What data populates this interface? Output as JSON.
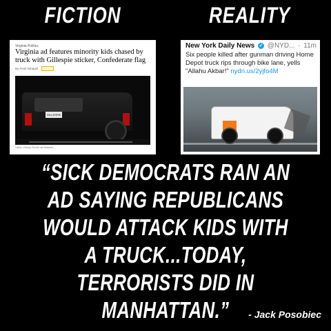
{
  "titles": {
    "left": "FICTION",
    "right": "REALITY"
  },
  "left_card": {
    "kicker": "Virginia Politics",
    "headline": "Virginia ad features minority kids chased by truck with Gillespie sticker, Confederate flag",
    "byline": "By Fenit Nirappil",
    "plate_text": "GILLESPIE",
    "caption": "Latino Victory Fund's ad features..."
  },
  "right_card": {
    "account_name": "New York Daily News",
    "handle": "@NYD...",
    "time": "11m",
    "tweet_text": "Six people killed after gunman driving Home Depot truck rips through bike lane, yells \"Allahu Akbar!\"",
    "link": "nydn.us/2yjfo4M"
  },
  "quote": "“SICK DEMOCRATS RAN AN AD SAYING REPUBLICANS WOULD ATTACK KIDS WITH A TRUCK...TODAY, TERRORISTS DID IN MANHATTAN.”",
  "attribution": "- Jack Posobiec",
  "colors": {
    "background": "#000000",
    "text": "#ffffff",
    "link": "#1b95e0",
    "verified": "#1da1f2"
  }
}
